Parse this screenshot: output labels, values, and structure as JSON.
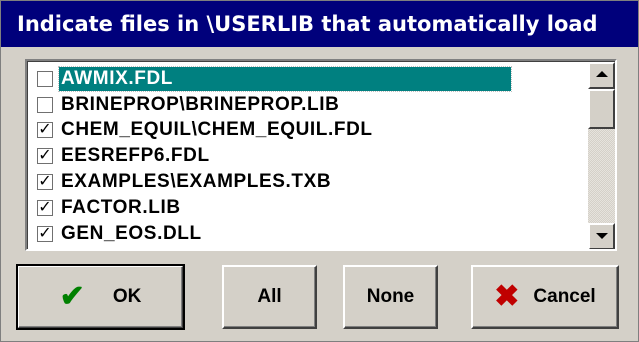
{
  "dialog": {
    "title": "Indicate files in \\USERLIB that automatically load"
  },
  "files": [
    {
      "label": "AWMIX.FDL",
      "checked": false,
      "selected": true
    },
    {
      "label": "BRINEPROP\\BRINEPROP.LIB",
      "checked": false,
      "selected": false
    },
    {
      "label": "CHEM_EQUIL\\CHEM_EQUIL.FDL",
      "checked": true,
      "selected": false
    },
    {
      "label": "EESREFP6.FDL",
      "checked": true,
      "selected": false
    },
    {
      "label": "EXAMPLES\\EXAMPLES.TXB",
      "checked": true,
      "selected": false
    },
    {
      "label": "FACTOR.LIB",
      "checked": true,
      "selected": false
    },
    {
      "label": "GEN_EOS.DLL",
      "checked": true,
      "selected": false
    }
  ],
  "checkmark_glyph": "✓",
  "buttons": {
    "ok": "OK",
    "all": "All",
    "none": "None",
    "cancel": "Cancel"
  },
  "icons": {
    "ok": "checkmark-icon",
    "cancel": "x-icon",
    "ok_color": "#008000",
    "cancel_color": "#c00000"
  },
  "colors": {
    "titlebar": "#00007b",
    "selection": "#008080",
    "face": "#d4d0c8"
  }
}
